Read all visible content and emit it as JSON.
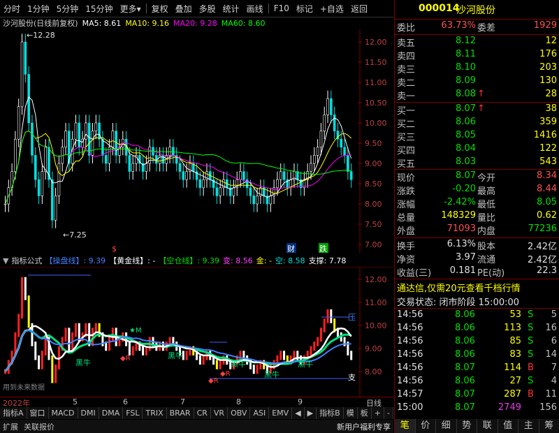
{
  "toolbar": {
    "items": [
      "分时",
      "1分钟",
      "5分钟",
      "15分钟",
      "更多",
      "复权",
      "叠加",
      "多股",
      "统计",
      "画线",
      "F10",
      "标记",
      "+自选",
      "返回"
    ],
    "more_suffix": "▾"
  },
  "chart": {
    "title": "沙河股份(日线前复权)",
    "ma": [
      {
        "label": "MA5: 8.61",
        "color": "#ffffff"
      },
      {
        "label": "MA10: 9.16",
        "color": "#ffff00"
      },
      {
        "label": "MA20: 9.28",
        "color": "#ff00ff"
      },
      {
        "label": "MA60: 8.60",
        "color": "#00ff00"
      }
    ],
    "high_label": "12.28",
    "low_label": "7.25",
    "yticks": [
      "12.00",
      "11.50",
      "11.00",
      "10.50",
      "10.00",
      "9.50",
      "9.00",
      "8.50",
      "8.00",
      "7.50",
      "7.00"
    ],
    "marker_cai": "财",
    "marker_die": "跌",
    "marker_dollar": "$"
  },
  "indicator": {
    "name": "指标公式",
    "parts": [
      {
        "text": "【操盘线】: 9.39",
        "color": "#4080ff"
      },
      {
        "text": "【黄金线】: -",
        "color": "#ffffff"
      },
      {
        "text": "【空仓线】: 9.39",
        "color": "#00e000"
      },
      {
        "text": "变: 8.56",
        "color": "#ff40ff"
      },
      {
        "text": "金: -",
        "color": "#ffff00"
      },
      {
        "text": "空: 8.58",
        "color": "#00e0e0"
      },
      {
        "text": "支撑: 7.78",
        "color": "#ffffff"
      }
    ],
    "yticks": [
      "12.00",
      "11.00",
      "10.00",
      "9.00",
      "8.00"
    ],
    "labels": {
      "heiniu": "黑牛",
      "star_m": "★M",
      "r": "◆R",
      "ya": "压",
      "zhi": "支",
      "future": "用到未来数据"
    }
  },
  "xaxis": {
    "labels": [
      "2022年",
      "5",
      "6",
      "7",
      "8",
      "9"
    ],
    "period": "日线"
  },
  "tabs": [
    "指标A",
    "窗口",
    "MACD",
    "DMI",
    "DMA",
    "FSL",
    "TRIX",
    "BRAR",
    "CR",
    "VR",
    "OBV",
    "ASI",
    "EMV",
    "◀",
    "▶",
    "指标B",
    "模",
    "板",
    "+",
    "-"
  ],
  "status": {
    "left1": "扩展",
    "left2": "关联报价",
    "right1": "新用户福利专享"
  },
  "quote": {
    "code": "000014",
    "name": "沙河股份",
    "weibi_label": "委比",
    "weibi": "63.73%",
    "weicha_label": "委差",
    "weicha": "1929",
    "sells": [
      {
        "label": "卖五",
        "price": "8.12",
        "vol": "12",
        "arrow": ""
      },
      {
        "label": "卖四",
        "price": "8.11",
        "vol": "176",
        "arrow": ""
      },
      {
        "label": "卖三",
        "price": "8.10",
        "vol": "203",
        "arrow": ""
      },
      {
        "label": "卖二",
        "price": "8.09",
        "vol": "130",
        "arrow": ""
      },
      {
        "label": "卖一",
        "price": "8.08",
        "vol": "28",
        "arrow": "↑"
      }
    ],
    "buys": [
      {
        "label": "买一",
        "price": "8.07",
        "vol": "38",
        "arrow": "↑"
      },
      {
        "label": "买二",
        "price": "8.06",
        "vol": "359",
        "arrow": ""
      },
      {
        "label": "买三",
        "price": "8.05",
        "vol": "1416",
        "arrow": ""
      },
      {
        "label": "买四",
        "price": "8.04",
        "vol": "122",
        "arrow": ""
      },
      {
        "label": "买五",
        "price": "8.03",
        "vol": "543",
        "arrow": ""
      }
    ],
    "stats": [
      {
        "l1": "现价",
        "v1": "8.07",
        "c1": "gr",
        "l2": "今开",
        "v2": "8.34",
        "c2": "hl"
      },
      {
        "l1": "涨跌",
        "v1": "-0.20",
        "c1": "gr",
        "l2": "最高",
        "v2": "8.44",
        "c2": "hl"
      },
      {
        "l1": "涨幅",
        "v1": "-2.42%",
        "c1": "gr",
        "l2": "最低",
        "v2": "8.05",
        "c2": "gr"
      },
      {
        "l1": "总量",
        "v1": "148329",
        "c1": "ye",
        "l2": "量比",
        "v2": "0.62",
        "c2": "ye"
      },
      {
        "l1": "外盘",
        "v1": "71093",
        "c1": "hl",
        "l2": "内盘",
        "v2": "77236",
        "c2": "gr"
      }
    ],
    "stats2": [
      {
        "l1": "换手",
        "v1": "6.13%",
        "l2": "股本",
        "v2": "2.42亿"
      },
      {
        "l1": "净资",
        "v1": "3.97",
        "l2": "流通",
        "v2": "2.42亿"
      },
      {
        "l1": "收益(三)",
        "v1": "0.181",
        "l2": "PE(动)",
        "v2": "22.3"
      }
    ],
    "ad": "通达信,仅需20元查看千档行情",
    "trade_status": "交易状态: 闭市阶段 15:00:00",
    "ticks": [
      {
        "t": "14:56",
        "p": "8.06",
        "v": "53",
        "d": "S",
        "n": "5"
      },
      {
        "t": "14:56",
        "p": "8.06",
        "v": "113",
        "d": "S",
        "n": "16"
      },
      {
        "t": "14:56",
        "p": "8.06",
        "v": "85",
        "d": "S",
        "n": "6"
      },
      {
        "t": "14:56",
        "p": "8.06",
        "v": "83",
        "d": "S",
        "n": "14"
      },
      {
        "t": "14:56",
        "p": "8.07",
        "v": "114",
        "d": "B",
        "n": "7"
      },
      {
        "t": "14:56",
        "p": "8.06",
        "v": "27",
        "d": "S",
        "n": "4"
      },
      {
        "t": "14:57",
        "p": "8.07",
        "v": "287",
        "d": "B",
        "n": "11"
      },
      {
        "t": "15:00",
        "p": "8.07",
        "v": "2749",
        "d": "",
        "n": "156"
      }
    ],
    "bottom_tabs": [
      "笔",
      "价",
      "细",
      "势",
      "联",
      "值",
      "主",
      "筹"
    ]
  }
}
